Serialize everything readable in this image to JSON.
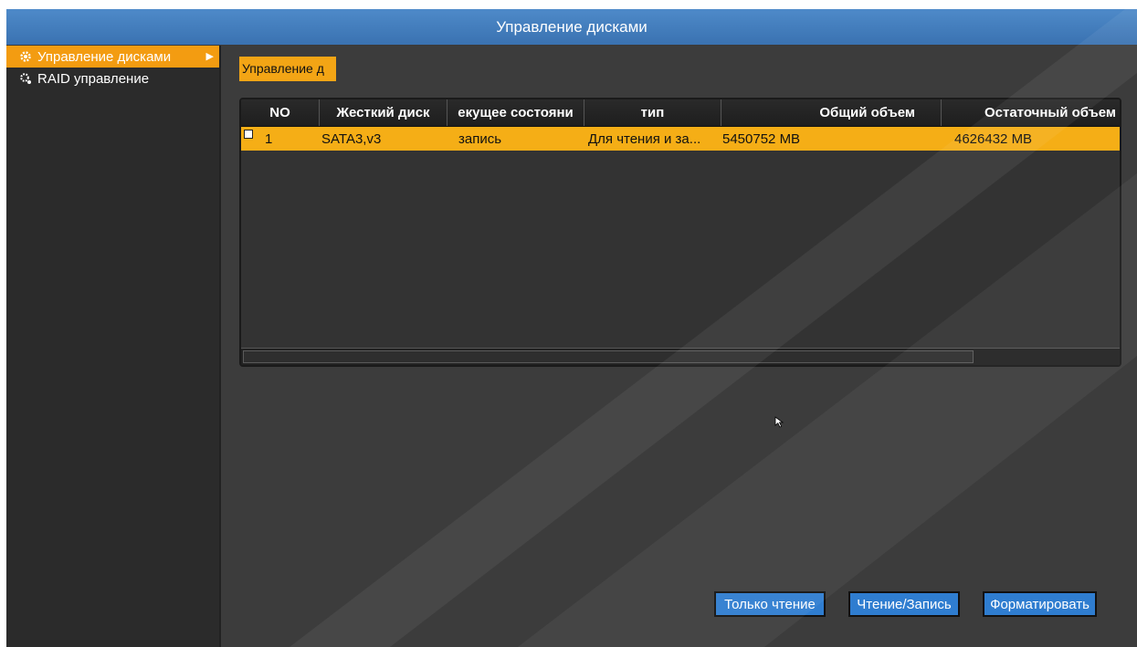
{
  "window": {
    "title": "Управление дисками"
  },
  "sidebar": {
    "items": [
      {
        "label": "Управление дисками",
        "icon": "gear-icon",
        "active": true
      },
      {
        "label": "RAID управление",
        "icon": "gears-icon",
        "active": false
      }
    ]
  },
  "tab": {
    "label": "Управление д"
  },
  "table": {
    "columns": [
      "NO",
      "Жесткий диск",
      "екущее состояни",
      "тип",
      "Общий объем",
      "Остаточный объем"
    ],
    "rows": [
      {
        "no": "1",
        "disk": "SATA3,v3",
        "state": "запись",
        "type": "Для чтения и за...",
        "total": "5450752 MB",
        "remain": "4626432 MB",
        "checked": false
      }
    ]
  },
  "buttons": {
    "readonly": "Только чтение",
    "readwrite": "Чтение/Запись",
    "format": "Форматировать"
  },
  "colors": {
    "accent": "#f5ae16",
    "title_bar": "#3f78b8",
    "button": "#2f7dd0"
  }
}
